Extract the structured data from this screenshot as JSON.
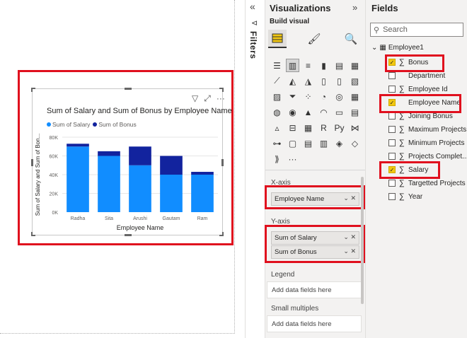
{
  "chart_data": {
    "type": "bar",
    "stacked": true,
    "title": "Sum of Salary and Sum of Bonus by Employee Name",
    "xlabel": "Employee Name",
    "ylabel": "Sum of Salary and Sum of Bon...",
    "categories": [
      "Radha",
      "Sita",
      "Arushi",
      "Gautam",
      "Ram"
    ],
    "series": [
      {
        "name": "Sum of Salary",
        "color": "#118dff",
        "values": [
          70000,
          60000,
          50000,
          40000,
          40000
        ]
      },
      {
        "name": "Sum of Bonus",
        "color": "#12239e",
        "values": [
          3000,
          5000,
          20000,
          20000,
          3000
        ]
      }
    ],
    "ylim": [
      0,
      80000
    ],
    "yticks": [
      "0K",
      "20K",
      "40K",
      "60K",
      "80K"
    ],
    "legend_position": "top-left",
    "grid": true
  },
  "filters": {
    "label": "Filters",
    "collapse_glyph": "«"
  },
  "visualizations": {
    "title": "Visualizations",
    "collapse_glyph": "»",
    "build_visual": "Build visual",
    "more": "···",
    "x_axis": {
      "label": "X-axis",
      "field": "Employee Name"
    },
    "y_axis": {
      "label": "Y-axis",
      "fields": [
        "Sum of Salary",
        "Sum of Bonus"
      ]
    },
    "legend": {
      "label": "Legend",
      "placeholder": "Add data fields here"
    },
    "small_multiples": {
      "label": "Small multiples",
      "placeholder": "Add data fields here"
    }
  },
  "fields": {
    "title": "Fields",
    "search_placeholder": "Search",
    "table": "Employee1",
    "items": [
      {
        "name": "Bonus",
        "checked": true,
        "sigma": true
      },
      {
        "name": "Department",
        "checked": false,
        "sigma": false
      },
      {
        "name": "Employee Id",
        "checked": false,
        "sigma": true
      },
      {
        "name": "Employee Name",
        "checked": true,
        "sigma": false
      },
      {
        "name": "Joining Bonus",
        "checked": false,
        "sigma": true
      },
      {
        "name": "Maximum Projects",
        "checked": false,
        "sigma": true
      },
      {
        "name": "Minimum Projects",
        "checked": false,
        "sigma": true
      },
      {
        "name": "Projects Complet...",
        "checked": false,
        "sigma": true
      },
      {
        "name": "Salary",
        "checked": true,
        "sigma": true
      },
      {
        "name": "Targetted Projects",
        "checked": false,
        "sigma": true
      },
      {
        "name": "Year",
        "checked": false,
        "sigma": true
      }
    ]
  },
  "colors": {
    "highlight": "#e0101e",
    "accent": "#f2c811"
  }
}
